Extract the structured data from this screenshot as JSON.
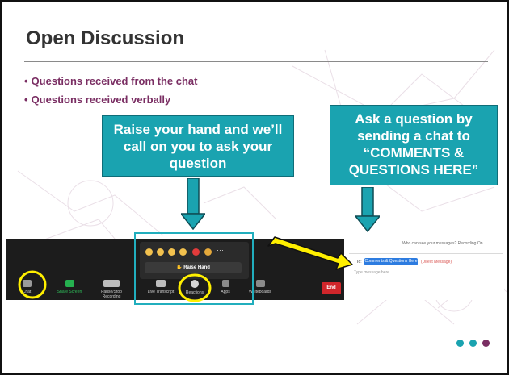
{
  "slide": {
    "title": "Open Discussion",
    "bullets": [
      "Questions received from the chat",
      "Questions received verbally"
    ],
    "callout_left": "Raise your hand and we’ll call on you to ask your question",
    "callout_right": "Ask a question by sending a chat to “COMMENTS & QUESTIONS HERE”",
    "accent_colors": {
      "teal": "#1aa3b0",
      "title_text": "#333333",
      "bullet_text": "#7a2e63",
      "highlight_yellow": "#ffef00"
    }
  },
  "zoom_toolbar": {
    "items": [
      {
        "label": "Chat",
        "icon": "chat-bubble-icon"
      },
      {
        "label": "Share Screen",
        "icon": "share-screen-icon"
      },
      {
        "label": "Pause/Stop Recording",
        "icon": "recording-icon"
      },
      {
        "label": "Live Transcript",
        "icon": "captions-icon"
      },
      {
        "label": "Reactions",
        "icon": "smiley-icon"
      },
      {
        "label": "Apps",
        "icon": "apps-icon"
      },
      {
        "label": "Whiteboards",
        "icon": "whiteboard-icon"
      }
    ],
    "end_label": "End"
  },
  "reactions_popup": {
    "emojis": [
      "clap-icon",
      "thumbs-up-icon",
      "laugh-icon",
      "wow-icon",
      "heart-icon",
      "tada-icon",
      "more-icon"
    ],
    "more_label": "···",
    "raise_hand_label": "✋ Raise Hand"
  },
  "chat_panel": {
    "who_can_see": "Who can see your messages? Recording On",
    "to_label": "To:",
    "recipient": "Comments & Questions Here ⌄",
    "direct_message": "(Direct Message)",
    "placeholder": "Type message here..."
  },
  "footer_dots": [
    "#1aa3b0",
    "#1aa3b0",
    "#7a2e63"
  ]
}
